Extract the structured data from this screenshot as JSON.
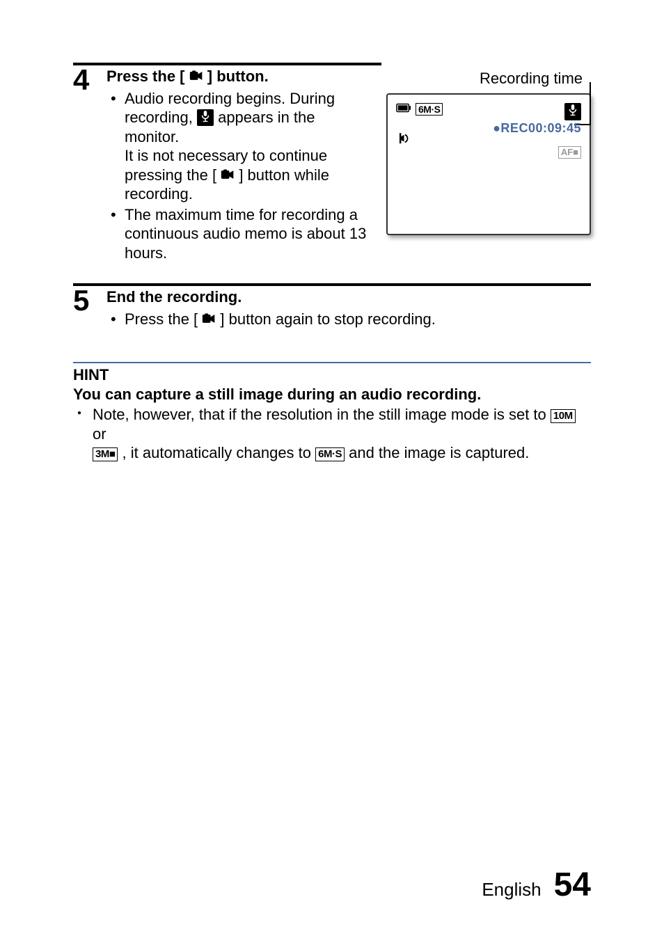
{
  "step4": {
    "number": "4",
    "title_a": "Press the [",
    "title_b": "] button.",
    "bullet1_a": "Audio recording begins. During recording, ",
    "bullet1_b": " appears in the monitor.",
    "bullet1_c": "It is not necessary to continue pressing the [",
    "bullet1_d": "] button while recording.",
    "bullet2": "The maximum time for recording a continuous audio memo is about 13 hours."
  },
  "figure": {
    "caption": "Recording time",
    "rec_label": "●REC00:09:45",
    "res_6ms": "6M·S",
    "af_lock": "AF■"
  },
  "step5": {
    "number": "5",
    "title": "End the recording.",
    "bullet1_a": "Press the [",
    "bullet1_b": "] button again to stop recording."
  },
  "hint": {
    "title": "HINT",
    "subtitle": "You can capture a still image during an audio recording.",
    "line_a": "Note, however, that if the resolution in the still image mode is set to ",
    "res10": "10M",
    "line_b": " or ",
    "res3": "3M■",
    "line_c": ", it automatically changes to ",
    "res6": "6M·S",
    "line_d": " and the image is captured."
  },
  "footer": {
    "lang": "English",
    "page": "54"
  }
}
